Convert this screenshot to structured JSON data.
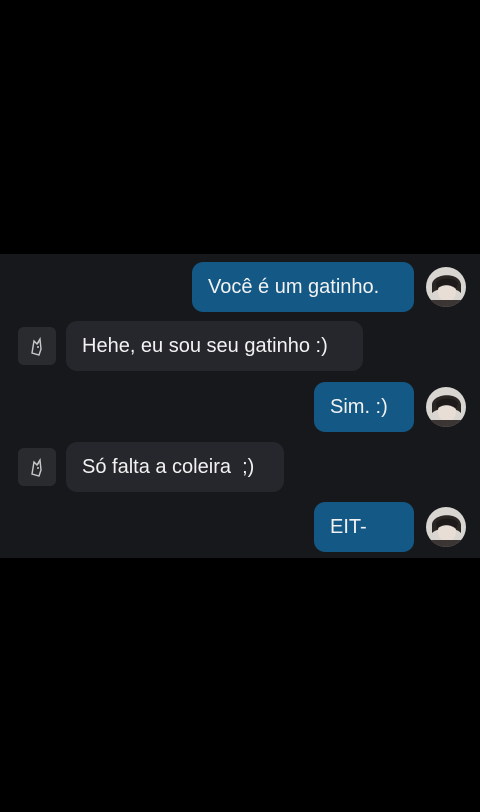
{
  "conversation": {
    "messages": [
      {
        "direction": "outgoing",
        "text": "Você é um gatinho."
      },
      {
        "direction": "incoming",
        "text": "Hehe, eu sou seu gatinho :)"
      },
      {
        "direction": "outgoing",
        "text": "Sim. :)"
      },
      {
        "direction": "incoming",
        "text": "Só falta a coleira  ;)"
      },
      {
        "direction": "outgoing",
        "text": "EIT-"
      }
    ]
  },
  "colors": {
    "background": "#000000",
    "chat_panel": "#17181c",
    "outgoing_bubble": "#145886",
    "incoming_bubble": "#26272c",
    "text": "#f2f2f2"
  }
}
